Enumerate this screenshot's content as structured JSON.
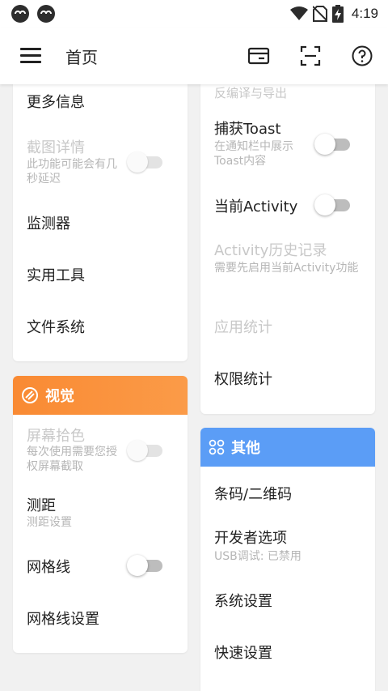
{
  "status_bar": {
    "time": "4:19",
    "icons": [
      "app-icon",
      "app-icon",
      "wifi-icon",
      "no-sim-icon",
      "battery-charging-icon"
    ]
  },
  "app_bar": {
    "title": "首页",
    "icons": [
      "menu-icon",
      "card-icon",
      "scan-icon",
      "help-icon"
    ]
  },
  "left_top_card": {
    "items": [
      {
        "label": "更多信息"
      },
      {
        "label": "截图详情",
        "desc": "此功能可能会有几秒延迟",
        "disabled": true,
        "toggle": "off"
      },
      {
        "label": "监测器"
      },
      {
        "label": "实用工具"
      },
      {
        "label": "文件系统"
      }
    ]
  },
  "visual_card": {
    "header": "视觉",
    "header_icon": "palette-icon",
    "color": "#fb8a2e",
    "items": [
      {
        "label": "屏幕拾色",
        "desc": "每次使用需要您授权屏幕截取",
        "disabled": true,
        "toggle": "off"
      },
      {
        "label": "测距",
        "desc": "测距设置"
      },
      {
        "label": "网格线",
        "toggle": "off"
      },
      {
        "label": "网格线设置"
      }
    ]
  },
  "right_top_card": {
    "items": [
      {
        "label": "反编译与导出",
        "disabled": true
      },
      {
        "label": "捕获Toast",
        "desc": "在通知栏中展示Toast内容",
        "toggle": "off"
      },
      {
        "label": "当前Activity",
        "toggle": "off"
      },
      {
        "label": "Activity历史记录",
        "desc": "需要先启用当前Activity功能",
        "disabled": true
      },
      {
        "label": "应用统计",
        "disabled": true
      },
      {
        "label": "权限统计"
      }
    ]
  },
  "other_card": {
    "header": "其他",
    "header_icon": "grid-icon",
    "color": "#5b9df6",
    "items": [
      {
        "label": "条码/二维码"
      },
      {
        "label": "开发者选项",
        "desc": "USB调试: 已禁用"
      },
      {
        "label": "系统设置"
      },
      {
        "label": "快速设置"
      }
    ]
  }
}
